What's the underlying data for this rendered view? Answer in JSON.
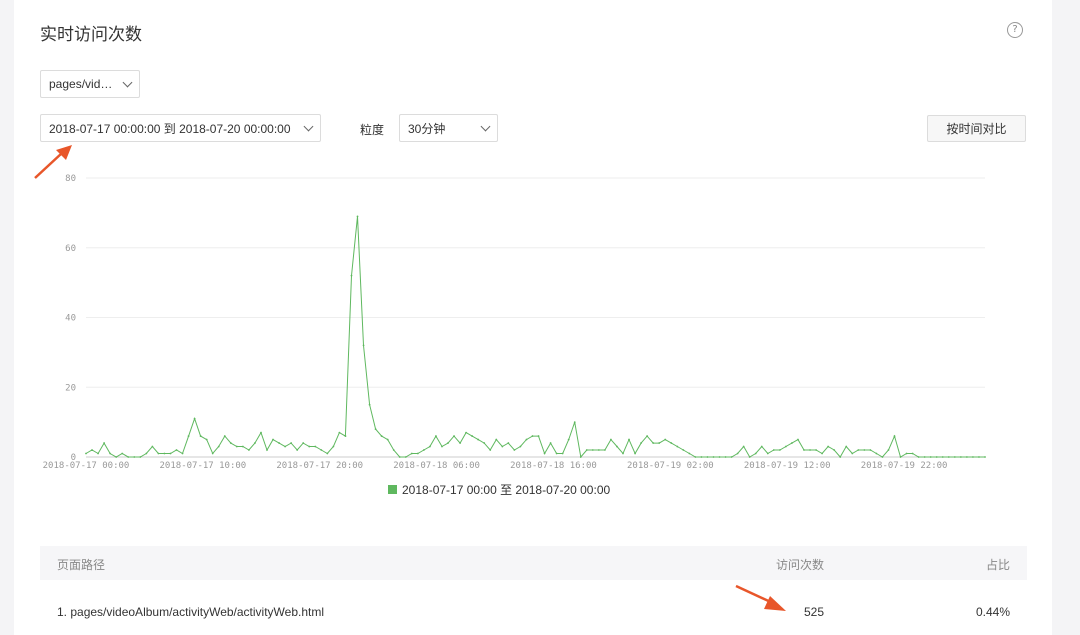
{
  "header": {
    "title": "实时访问次数",
    "help_icon": "question-circle-icon"
  },
  "filters": {
    "page_select": "pages/vid…",
    "date_range": "2018-07-17 00:00:00 到 2018-07-20 00:00:00",
    "granularity_label": "粒度",
    "granularity_value": "30分钟",
    "compare_button": "按时间对比"
  },
  "colors": {
    "series": "#5fb85f",
    "arrow": "#e8562a",
    "grid": "#eeeeee"
  },
  "chart_data": {
    "type": "line",
    "yticks": [
      0,
      20,
      40,
      60,
      80
    ],
    "ylim": [
      0,
      80
    ],
    "xtick_labels": [
      "2018-07-17 00:00",
      "2018-07-17 10:00",
      "2018-07-17 20:00",
      "2018-07-18 06:00",
      "2018-07-18 16:00",
      "2018-07-19 02:00",
      "2018-07-19 12:00",
      "2018-07-19 22:00"
    ],
    "series": [
      {
        "name": "2018-07-17 00:00 至 2018-07-20 00:00",
        "values": [
          1,
          2,
          1,
          4,
          1,
          0,
          1,
          0,
          0,
          0,
          1,
          3,
          1,
          1,
          1,
          2,
          1,
          6,
          11,
          6,
          5,
          1,
          3,
          6,
          4,
          3,
          3,
          2,
          4,
          7,
          2,
          5,
          4,
          3,
          4,
          2,
          4,
          3,
          3,
          2,
          1,
          3,
          7,
          6,
          52,
          69,
          32,
          15,
          8,
          6,
          5,
          2,
          0,
          0,
          1,
          1,
          2,
          3,
          6,
          3,
          4,
          6,
          4,
          7,
          6,
          5,
          4,
          2,
          5,
          3,
          4,
          2,
          3,
          5,
          6,
          6,
          1,
          4,
          1,
          1,
          5,
          10,
          0,
          2,
          2,
          2,
          2,
          5,
          3,
          1,
          5,
          1,
          4,
          6,
          4,
          4,
          5,
          4,
          3,
          2,
          1,
          0,
          0,
          0,
          0,
          0,
          0,
          0,
          1,
          3,
          0,
          1,
          3,
          1,
          2,
          2,
          3,
          4,
          5,
          2,
          2,
          2,
          1,
          3,
          2,
          0,
          3,
          1,
          2,
          2,
          2,
          1,
          0,
          2,
          6,
          0,
          1,
          1,
          0,
          0,
          0,
          0,
          0,
          0,
          0,
          0,
          0,
          0,
          0,
          0
        ]
      }
    ]
  },
  "legend": {
    "label": "2018-07-17 00:00 至 2018-07-20 00:00"
  },
  "table": {
    "headers": {
      "path": "页面路径",
      "count": "访问次数",
      "ratio": "占比"
    },
    "rows": [
      {
        "path": "1. pages/videoAlbum/activityWeb/activityWeb.html",
        "count": "525",
        "ratio": "0.44%"
      }
    ]
  }
}
